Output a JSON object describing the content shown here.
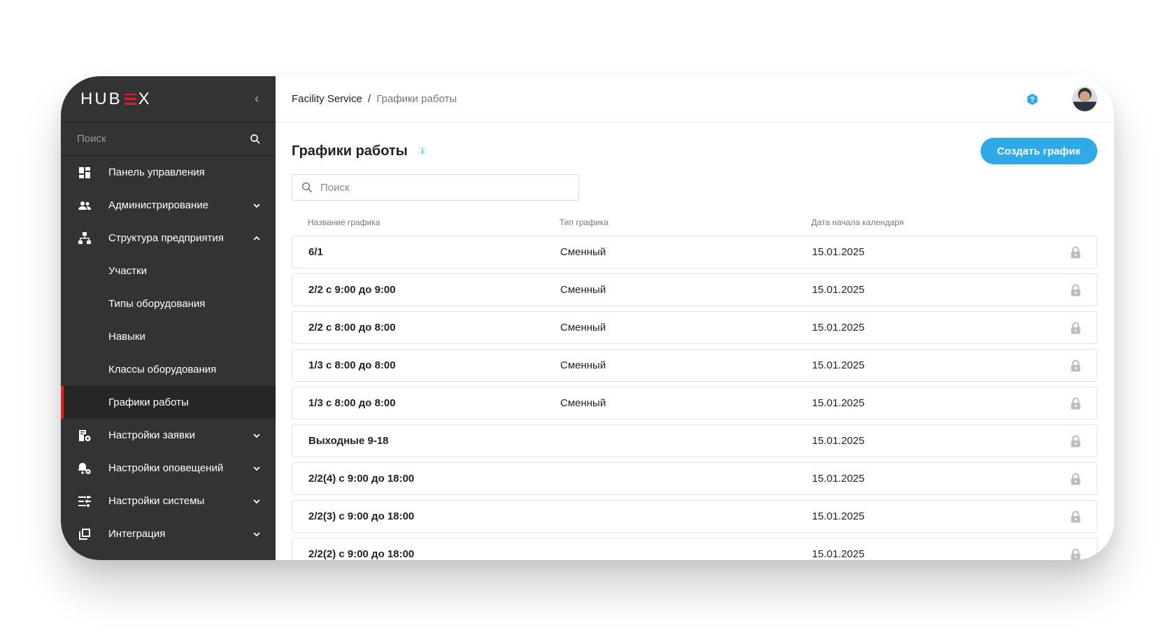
{
  "sidebar": {
    "logo": "HUBEX",
    "search_placeholder": "Поиск",
    "items": [
      {
        "label": "Панель управления",
        "icon": "dashboard-icon"
      },
      {
        "label": "Администрирование",
        "icon": "users-icon",
        "expandable": true
      },
      {
        "label": "Структура предприятия",
        "icon": "structure-icon",
        "expanded": true
      },
      {
        "label": "Участки",
        "sub": true
      },
      {
        "label": "Типы оборудования",
        "sub": true
      },
      {
        "label": "Навыки",
        "sub": true
      },
      {
        "label": "Классы оборудования",
        "sub": true
      },
      {
        "label": "Графики работы",
        "sub": true,
        "active": true
      },
      {
        "label": "Настройки заявки",
        "icon": "request-settings-icon",
        "expandable": true
      },
      {
        "label": "Настройки оповещений",
        "icon": "notification-settings-icon",
        "expandable": true
      },
      {
        "label": "Настройки системы",
        "icon": "system-settings-icon",
        "expandable": true
      },
      {
        "label": "Интеграция",
        "icon": "integration-icon",
        "expandable": true
      }
    ]
  },
  "breadcrumb": {
    "root": "Facility Service",
    "separator": "/",
    "current": "Графики работы"
  },
  "page": {
    "title": "Графики работы",
    "create_button": "Создать график",
    "search_placeholder": "Поиск"
  },
  "table": {
    "headers": [
      "Название графика",
      "Тип графика",
      "Дата начала календаря"
    ],
    "rows": [
      {
        "name": "6/1",
        "type": "Сменный",
        "date": "15.01.2025"
      },
      {
        "name": "2/2 с 9:00 до 9:00",
        "type": "Сменный",
        "date": "15.01.2025"
      },
      {
        "name": "2/2 с 8:00 до 8:00",
        "type": "Сменный",
        "date": "15.01.2025"
      },
      {
        "name": "1/3 с 8:00 до 8:00",
        "type": "Сменный",
        "date": "15.01.2025"
      },
      {
        "name": "1/3 с 8:00 до 8:00",
        "type": "Сменный",
        "date": "15.01.2025"
      },
      {
        "name": "Выходные 9-18",
        "type": "",
        "date": "15.01.2025"
      },
      {
        "name": "2/2(4) с 9:00 до 18:00",
        "type": "",
        "date": "15.01.2025"
      },
      {
        "name": "2/2(3) с 9:00 до 18:00",
        "type": "",
        "date": "15.01.2025"
      },
      {
        "name": "2/2(2) с 9:00 до 18:00",
        "type": "",
        "date": "15.01.2025"
      }
    ]
  },
  "colors": {
    "sidebar_bg": "#333333",
    "accent_red": "#e31e24",
    "primary_blue": "#2fa9e8"
  }
}
